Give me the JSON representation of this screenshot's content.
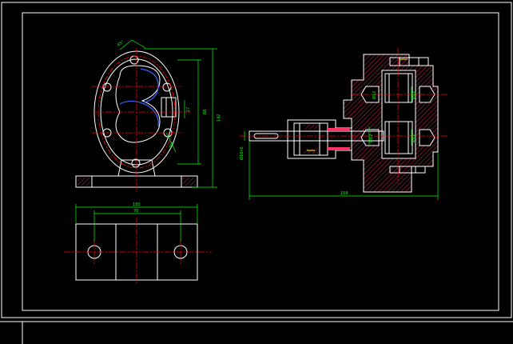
{
  "drawing": {
    "title": "",
    "colors": {
      "background": "#000000",
      "frame": "#ffffff",
      "outline": "#ffffff",
      "dimension": "#00ff00",
      "centerline": "#ff0000",
      "hatch": "#ff3366",
      "highlight": "#3366ff",
      "accent": "#ffff00"
    }
  },
  "front_view": {
    "dims": {
      "chamfer": "45°",
      "height_outer": "142",
      "height_inner": "88",
      "port": "27",
      "angle": "45°"
    }
  },
  "top_view": {
    "dims": {
      "width_total": "180",
      "hole_spacing": "70"
    }
  },
  "section_view": {
    "dims": {
      "length": "158",
      "shaft": "Ø16h6",
      "bore_1": "Ø12",
      "bore_2": "Ø12",
      "bore_3": "Ø12",
      "bore_4": "Ø12"
    }
  }
}
